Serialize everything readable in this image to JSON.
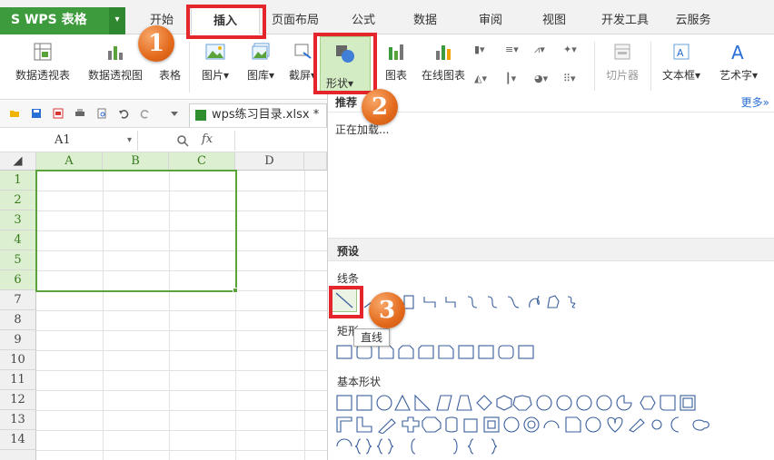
{
  "app": {
    "brand": "WPS 表格",
    "brand_mark": "S",
    "brand_menu_glyph": "▾"
  },
  "tabs": [
    {
      "label": "开始"
    },
    {
      "label": "插入"
    },
    {
      "label": "页面布局"
    },
    {
      "label": "公式"
    },
    {
      "label": "数据"
    },
    {
      "label": "审阅"
    },
    {
      "label": "视图"
    },
    {
      "label": "开发工具"
    },
    {
      "label": "云服务"
    }
  ],
  "ribbon": {
    "pivot_table": "数据透视表",
    "pivot_chart": "数据透视图",
    "table": "表格",
    "picture": "图片",
    "gallery": "图库",
    "screenshot": "截屏",
    "shapes": "形状",
    "chart": "图表",
    "online_chart": "在线图表",
    "slicer": "切片器",
    "textbox": "文本框",
    "wordart": "艺术字",
    "dropdown_glyph": "▾"
  },
  "document": {
    "tab_label": "wps练习目录.xlsx *"
  },
  "formula_bar": {
    "cell_ref": "A1",
    "fx_label": "fx"
  },
  "grid": {
    "columns": [
      "A",
      "B",
      "C",
      "D"
    ],
    "rows": [
      "1",
      "2",
      "3",
      "4",
      "5",
      "6",
      "7",
      "8",
      "9",
      "10",
      "11",
      "12",
      "13",
      "14"
    ]
  },
  "shapes_panel": {
    "recommended": "推荐",
    "more": "更多»",
    "loading": "正在加载...",
    "presets": "预设",
    "lines": "线条",
    "rectangles": "矩形",
    "basic_shapes": "基本形状",
    "tooltip": "直线"
  },
  "annotations": {
    "step1": "1",
    "step2": "2",
    "step3": "3"
  },
  "colors": {
    "brand_green": "#3d9b3d",
    "highlight_red": "#e4262c",
    "badge_orange": "#e36a1c",
    "selection_green": "#5aa33a"
  }
}
